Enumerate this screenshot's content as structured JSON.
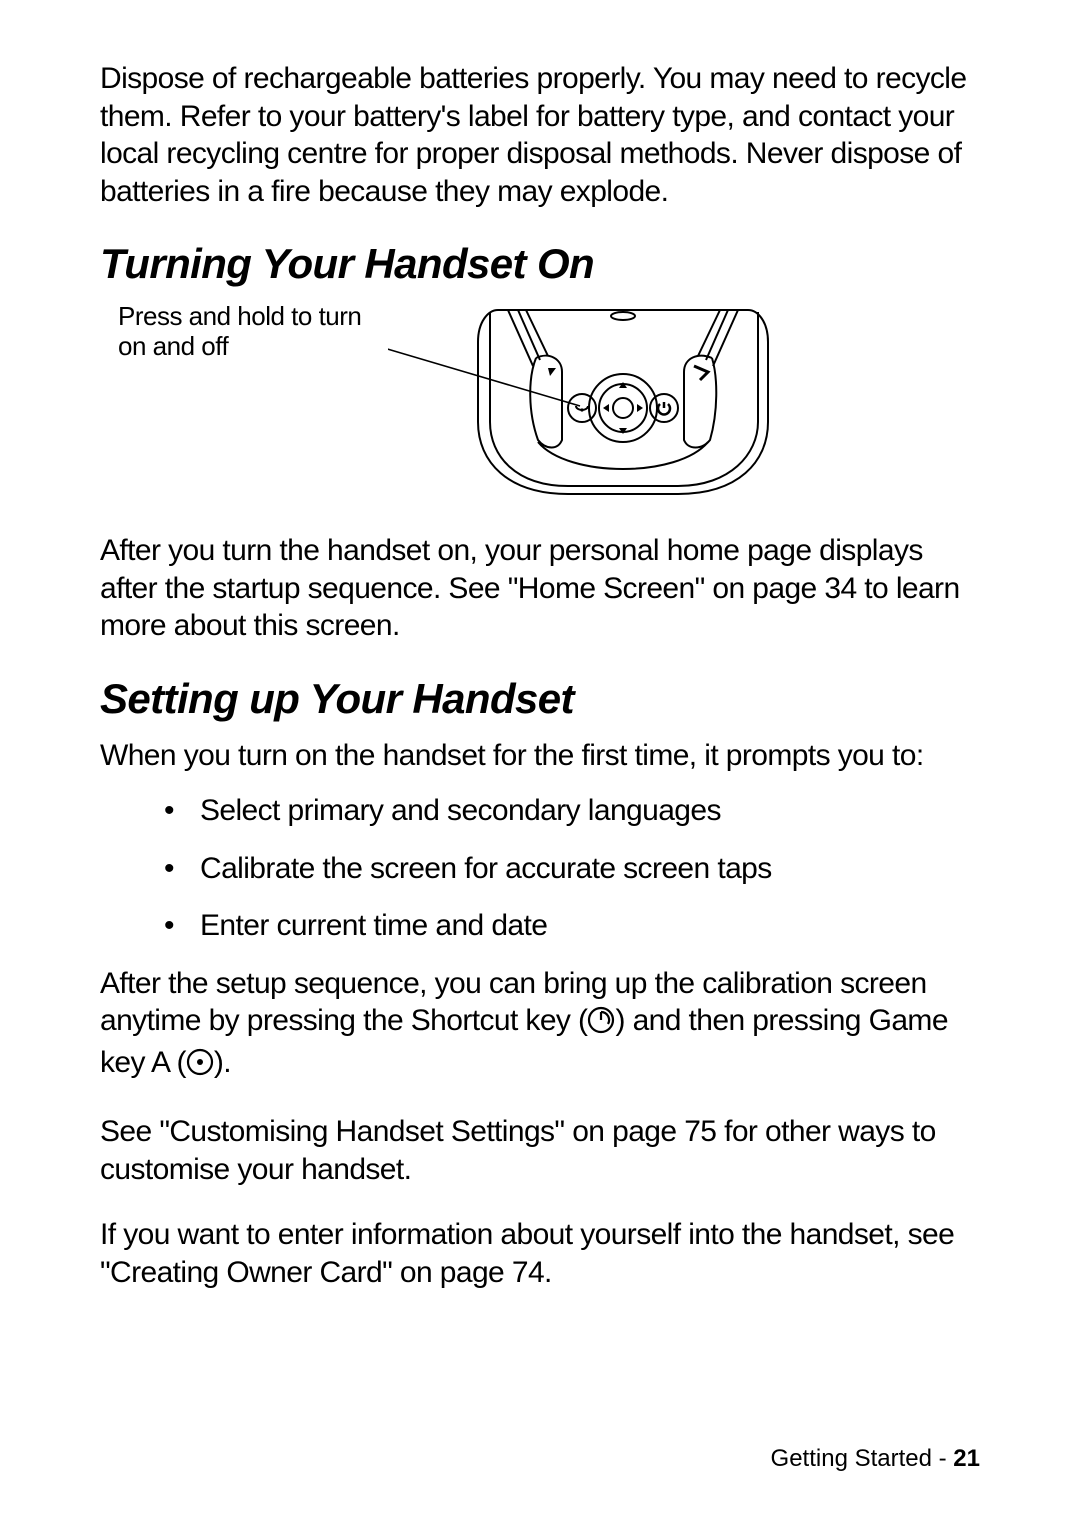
{
  "intro_para": "Dispose of rechargeable batteries properly. You may need to recycle them. Refer to your battery's label for battery type, and contact your local recycling centre for proper disposal methods. Never dispose of batteries in a fire because they may explode.",
  "heading1": "Turning Your Handset On",
  "callout": "Press and hold to turn on and off",
  "after_turn_on": "After you turn the handset on, your personal home page displays after the startup sequence. See \"Home Screen\" on page 34 to learn more about this screen.",
  "heading2": "Setting up Your Handset",
  "setup_intro": "When you turn on the handset for the first time, it prompts you to:",
  "bullets": [
    "Select primary and secondary languages",
    "Calibrate the screen for accurate screen taps",
    "Enter current time and date"
  ],
  "after_setup": {
    "pre": "After the setup sequence, you can bring up the calibration screen anytime by pressing the Shortcut key (",
    "mid": ") and then pressing Game key A (",
    "post": ")."
  },
  "customise_para": "See \"Customising Handset Settings\" on page 75 for other ways to customise your handset.",
  "owner_para": "If you want to enter information about yourself into the handset, see \"Creating Owner Card\" on page 74.",
  "footer": {
    "section": "Getting Started - ",
    "page": "21"
  }
}
